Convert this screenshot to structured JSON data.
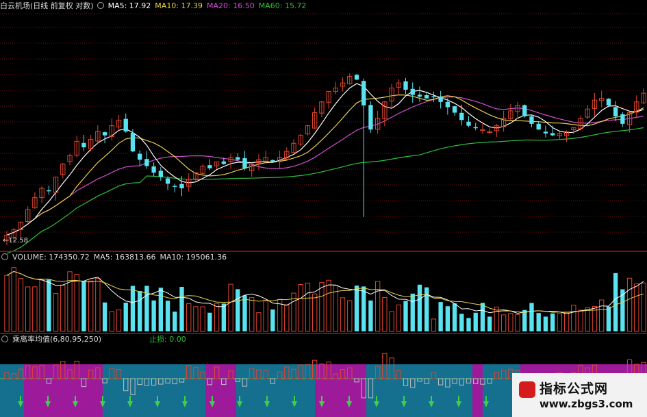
{
  "panel1": {
    "title": "白云机场(日线 前复权 对数)",
    "ma5": "MA5: 17.92",
    "ma10": "MA10: 17.39",
    "ma20": "MA20: 16.50",
    "ma60": "MA60: 15.72",
    "low_label": "12.58"
  },
  "panel2": {
    "volume": "VOLUME: 174350.72",
    "ma5": "MA5: 163813.66",
    "ma10": "MA10: 195061.36"
  },
  "panel3": {
    "title": "乘离率均值(6,80,95,250)",
    "stop": "止损: 0.00"
  },
  "watermark": {
    "line1": "指标公式网",
    "line2": "www.zbgs3.com"
  },
  "colors": {
    "up": "#e0462e",
    "down": "#59e3f0",
    "ma5": "#ffffff",
    "ma10": "#e8d24a",
    "ma20": "#d050d0",
    "ma60": "#2fbf3a",
    "grid": "#6a1010",
    "band_purple": "#9d1b9b",
    "band_blue": "#156f8f"
  },
  "chart_data": [
    {
      "type": "candlestick",
      "title": "白云机场(日线 前复权 对数)",
      "series": [
        {
          "name": "MA5",
          "last": 17.92
        },
        {
          "name": "MA10",
          "last": 17.39
        },
        {
          "name": "MA20",
          "last": 16.5
        },
        {
          "name": "MA60",
          "last": 15.72
        }
      ],
      "annotations": [
        {
          "label": "12.58",
          "note": "lowest price"
        }
      ],
      "y_scale": "log",
      "close": [
        12.6,
        12.8,
        13.1,
        13.6,
        14.1,
        14.5,
        14.4,
        15.0,
        15.6,
        16.0,
        16.7,
        16.4,
        16.8,
        17.2,
        17.0,
        17.5,
        17.8,
        17.2,
        16.2,
        15.8,
        15.5,
        15.2,
        15.0,
        14.7,
        14.6,
        14.5,
        14.9,
        15.2,
        15.5,
        15.4,
        15.7,
        15.6,
        15.9,
        15.8,
        15.4,
        15.6,
        15.8,
        15.9,
        15.7,
        15.9,
        16.2,
        16.6,
        17.0,
        17.5,
        18.2,
        18.8,
        19.4,
        19.6,
        19.9,
        20.3,
        20.1,
        18.6,
        17.3,
        17.9,
        18.8,
        19.6,
        19.9,
        19.5,
        19.2,
        19.1,
        19.0,
        19.1,
        18.8,
        18.5,
        18.2,
        17.8,
        17.5,
        17.4,
        17.3,
        17.2,
        17.5,
        17.9,
        18.3,
        18.6,
        18.0,
        17.6,
        17.3,
        17.1,
        17.0,
        17.1,
        17.2,
        17.4,
        17.9,
        18.4,
        18.9,
        19.0,
        18.6,
        18.0,
        17.6,
        18.2,
        18.8,
        19.3
      ]
    },
    {
      "type": "bar",
      "title": "VOLUME",
      "series": [
        {
          "name": "VOLUME",
          "last": 174350.72
        },
        {
          "name": "MA5",
          "last": 163813.66
        },
        {
          "name": "MA10",
          "last": 195061.36
        }
      ]
    },
    {
      "type": "bar",
      "title": "乘离率均值(6,80,95,250)",
      "series": [
        {
          "name": "止损",
          "last": 0.0
        }
      ]
    }
  ]
}
